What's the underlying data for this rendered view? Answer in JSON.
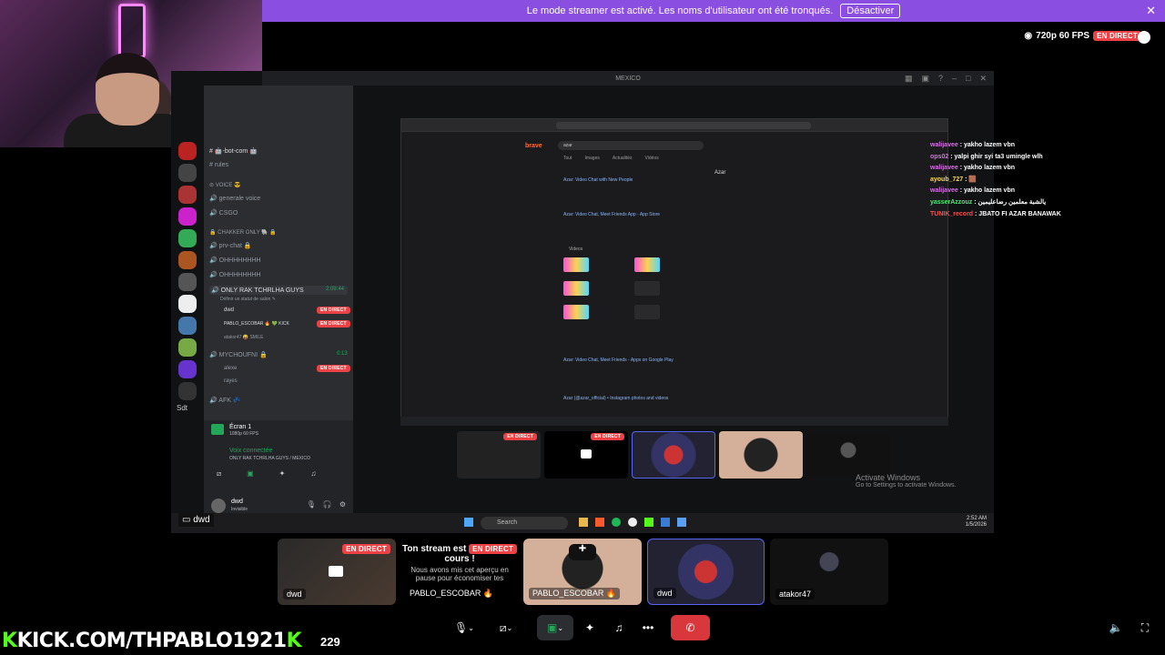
{
  "banner": {
    "text": "Le mode streamer est activé. Les noms d'utilisateur ont été tronqués.",
    "button": "Désactiver",
    "close_icon": "close-icon"
  },
  "stats": {
    "quality": "720p 60 FPS",
    "live": "EN DIRECT"
  },
  "screen": {
    "window_title": "MEXICO",
    "channels": [
      {
        "label": "#  🤖-bot-com 🤖",
        "type": "text"
      },
      {
        "label": "#  rules",
        "type": "text"
      },
      {
        "label": "⊘ VOICE 😎",
        "type": "category"
      },
      {
        "label": "🔊 generale voice",
        "type": "voice"
      },
      {
        "label": "🔊 CSGO",
        "type": "voice"
      },
      {
        "label": "🔒 CHAKKER ONLY 🐘 🔒",
        "type": "category"
      },
      {
        "label": "🔊 prv-chat 🔒",
        "type": "voice"
      },
      {
        "label": "🔊 OHHHHHHHH",
        "type": "voice"
      },
      {
        "label": "🔊 OHHHHHHHH",
        "type": "voice"
      },
      {
        "label": "🔊 ONLY RAK TCHRLHA GUYS",
        "type": "voice-active"
      },
      {
        "label": "Définir un statut de salon ✎",
        "type": "status"
      },
      {
        "label": "dwd",
        "type": "member"
      },
      {
        "label": "PABLO_ESCOBAR 🔥  💚 KICK",
        "type": "member"
      },
      {
        "label": "atakor47  😝 SMILE",
        "type": "member"
      },
      {
        "label": "🔊 MYCHOUFNI 🔒",
        "type": "voice"
      },
      {
        "label": "alexe",
        "type": "member"
      },
      {
        "label": "rayes",
        "type": "member"
      },
      {
        "label": "🔊 AFK 💤",
        "type": "voice"
      }
    ],
    "session_timer": "2:09:44",
    "other_timer": "0:13",
    "sdt_label": "Sdt",
    "screen_share": "Écran 1",
    "screen_share_sub": "1080p 60 FPS",
    "voice_connected": "Voix connectée",
    "voice_channel": "ONLY RAK TCHRLHA GUYS / MEXICO",
    "user": "dwd",
    "user_status": "Invisible",
    "browser": {
      "brand": "brave",
      "query": "azar",
      "tabs": [
        "Tout",
        "Images",
        "Actualités",
        "Vidéos"
      ],
      "results": [
        "Azar: Video Chat with New People",
        "Azar: Video Chat, Meet Friends App - App Store",
        "Videos",
        "Azar: Video Chat, Meet Friends - Apps on Google Play",
        "Azar (@azar_official) • Instagram photos and videos"
      ],
      "side_title": "Azar"
    }
  },
  "chat": [
    {
      "user": "walijavee",
      "msg": ": yakho lazem vbn"
    },
    {
      "user": "ops02",
      "msg": ": yalpi ghir syi ta3 umingle wlh"
    },
    {
      "user": "walijavee",
      "msg": ": yakho lazem vbn"
    },
    {
      "user": "ayoub_727",
      "msg": ": 🟫"
    },
    {
      "user": "walijavee",
      "msg": ": yakho lazem vbn"
    },
    {
      "user": "yasserAzzouz",
      "msg": ": يالشبة معلمين رضاعليمين"
    },
    {
      "user": "TUNIK_record",
      "msg": ": JBATO FI AZAR BANAWAK"
    }
  ],
  "stage_thumbs": [
    {
      "live": "EN DIRECT"
    },
    {
      "live": "EN DIRECT"
    },
    {},
    {},
    {}
  ],
  "activate": {
    "title": "Activate Windows",
    "subtitle": "Go to Settings to activate Windows."
  },
  "taskbar": {
    "search": "Search",
    "time": "2:52 AM",
    "date": "1/5/2026"
  },
  "tooltip": "dwd",
  "bottom_tiles": [
    {
      "name": "dwd",
      "live": "EN DIRECT"
    },
    {
      "title": "Ton stream est",
      "live": "EN DIRECT",
      "title2": "cours !",
      "body": "Nous avons mis cet aperçu en pause pour économiser tes",
      "name": "PABLO_ESCOBAR 🔥"
    },
    {
      "name": "PABLO_ESCOBAR 🔥"
    },
    {
      "name": "dwd"
    },
    {
      "name": "atakor47"
    }
  ],
  "kick": {
    "prefix": "K",
    "url": "KICK.COM/THPABLO1921",
    "suffix": "K",
    "viewers": "229"
  },
  "colors": {
    "banner": "#8a4fe0",
    "live": "#ed4245",
    "kick": "#53fc18",
    "end_call": "#da373c"
  }
}
